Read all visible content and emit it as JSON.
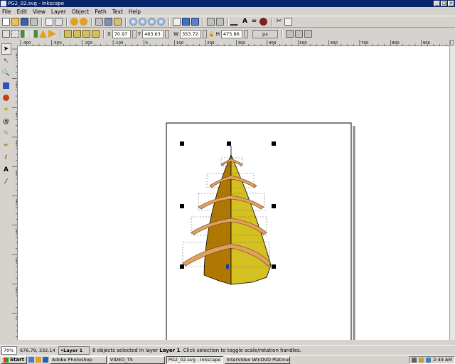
{
  "window": {
    "title": "PG2_02.svg - Inkscape"
  },
  "menu": [
    "File",
    "Edit",
    "View",
    "Layer",
    "Object",
    "Path",
    "Text",
    "Help"
  ],
  "controls": {
    "x_label": "X",
    "x_value": "70.97",
    "y_label": "Y",
    "y_value": "483.63",
    "w_label": "W",
    "w_value": "353.72",
    "h_label": "H",
    "h_value": "475.86",
    "unit": "px"
  },
  "ruler": {
    "h_ticks": [
      "-400",
      "-500",
      "-200",
      "-100",
      "0",
      "100",
      "200",
      "300",
      "400",
      "500",
      "600",
      "700",
      "800",
      "900"
    ],
    "v_ticks": [
      "900",
      "800",
      "700",
      "600",
      "500",
      "400",
      "300",
      "200",
      "100",
      "0"
    ]
  },
  "status": {
    "zoom": "70%",
    "coords": "676.79, 332.14",
    "layer": "•Layer 1",
    "message_prefix": "8 objects selected in layer ",
    "message_layer": "Layer 1",
    "message_suffix": ". Click selection to toggle scale/rotation handles."
  },
  "taskbar": {
    "start": "Start",
    "tasks": [
      "Adobe Photoshop",
      "VIDEO_TS",
      "PG2_02.svg - Inkscape",
      "InterVideo WinDVD Platinum"
    ],
    "active_index": 2,
    "clock": "2:49 AM"
  },
  "colors": {
    "title_bg": "#0a246a",
    "chrome": "#d6d3ce",
    "dark_ochre": "#b07800",
    "yellow": "#d4c020",
    "rib": "#e0a060"
  }
}
